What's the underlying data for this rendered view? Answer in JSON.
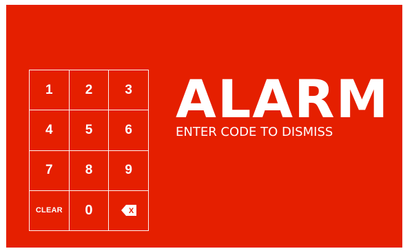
{
  "alarm": {
    "title": "ALARM",
    "subtitle": "ENTER CODE TO DISMISS"
  },
  "keypad": {
    "keys": [
      "1",
      "2",
      "3",
      "4",
      "5",
      "6",
      "7",
      "8",
      "9",
      "CLEAR",
      "0"
    ],
    "backspace_icon": "backspace-icon",
    "backspace_glyph": "X"
  },
  "colors": {
    "background": "#e51f00",
    "foreground": "#ffffff"
  }
}
